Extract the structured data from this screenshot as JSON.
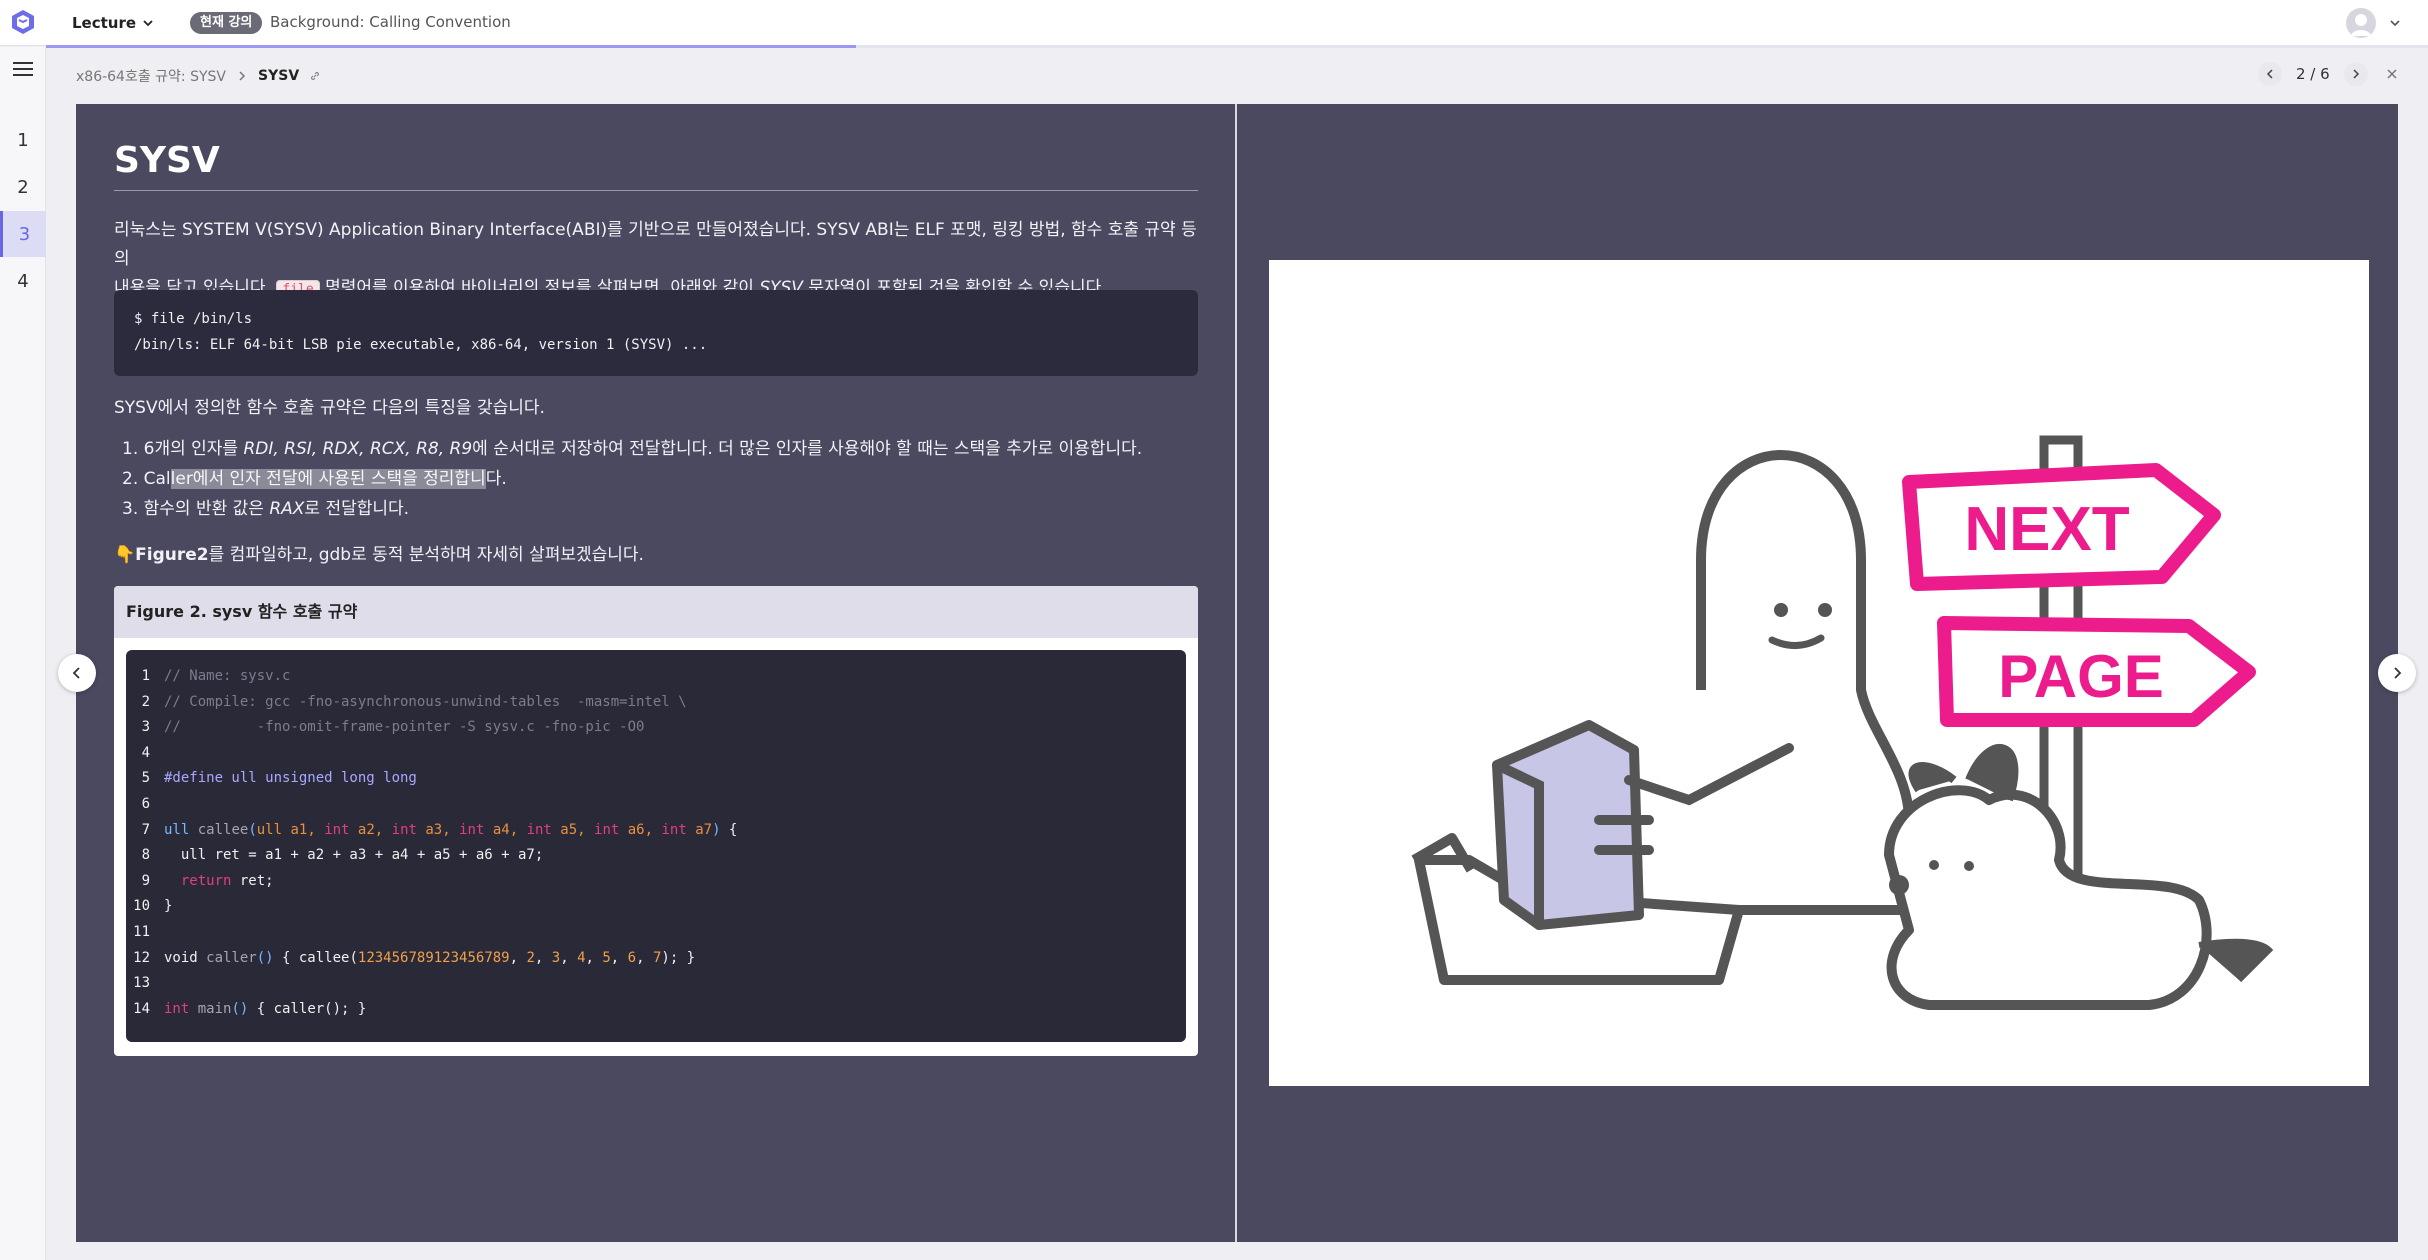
{
  "topbar": {
    "lecture_label": "Lecture",
    "current_badge": "현재 강의",
    "current_title": "Background: Calling Convention",
    "progress_fraction": 0.34
  },
  "rail": {
    "items": [
      {
        "label": "1"
      },
      {
        "label": "2"
      },
      {
        "label": "3"
      },
      {
        "label": "4"
      }
    ],
    "active_index": 2
  },
  "breadcrumb": {
    "parent": "x86-64호출 규약: SYSV",
    "current": "SYSV"
  },
  "pager": {
    "text": "2 / 6"
  },
  "slide": {
    "title": "SYSV",
    "intro_line1": "리눅스는 SYSTEM V(SYSV) Application Binary Interface(ABI)를 기반으로 만들어졌습니다. SYSV ABI는 ELF 포맷, 링킹 방법, 함수 호출 규약 등의",
    "intro_line2_a": "내용을 담고 있습니다. ",
    "intro_code": "file",
    "intro_line2_b": " 명령어를 이용하여 바이너리의 정보를 살펴보면, 아래와 같이 ",
    "intro_italic": "SYSV",
    "intro_line2_c": " 문자열이 포함된 것을 확인할 수 있습니다.",
    "terminal": [
      "$ file /bin/ls",
      "/bin/ls: ELF 64-bit LSB pie executable, x86-64, version 1 (SYSV) ..."
    ],
    "features_intro": "SYSV에서 정의한 함수 호출 규약은 다음의 특징을 갖습니다.",
    "features": {
      "f1_a": "1. 6개의 인자를 ",
      "f1_regs": "RDI, RSI, RDX, RCX, R8, R9",
      "f1_b": "에 순서대로 저장하여 전달합니다. 더 많은 인자를 사용해야 할 때는 스택을 추가로 이용합니다.",
      "f2_a": "2. Cal",
      "f2_hl": "ler에서 인자 전달에 사용된 스택을 정리합니",
      "f2_b": "다.",
      "f3_a": "3. 함수의 반환 값은 ",
      "f3_reg": "RAX",
      "f3_b": "로 전달합니다."
    },
    "hint_emoji": "👇",
    "hint_bold": "Figure2",
    "hint_rest": "를 컴파일하고, gdb로 동적 분석하며 자세히 살펴보겠습니다.",
    "figure_caption": "Figure 2. sysv 함수 호출 규약"
  },
  "code": {
    "line_numbers": [
      "1",
      "2",
      "3",
      "4",
      "5",
      "6",
      "7",
      "8",
      "9",
      "10",
      "11",
      "12",
      "13",
      "14"
    ],
    "l1": "// Name: sysv.c",
    "l2": "// Compile: gcc -fno-asynchronous-unwind-tables  -masm=intel \\",
    "l3": "//         -fno-omit-frame-pointer -S sysv.c -fno-pic -O0",
    "l5": "#define ull unsigned long long",
    "l7": {
      "t1": "ull",
      "fn": "callee",
      "p1": "(",
      "a1t": "ull",
      "a1": " a1, ",
      "k2": "int",
      "a2": " a2, ",
      "k3": "int",
      "a3": " a3, ",
      "k4": "int",
      "a4": " a4, ",
      "k5": "int",
      "a5": " a5, ",
      "k6": "int",
      "a6": " a6, ",
      "k7": "int",
      "a7": " a7",
      "p2": ")",
      "end": " {"
    },
    "l8": "  ull ret = a1 + a2 + a3 + a4 + a5 + a6 + a7;",
    "l9_kw": "return",
    "l9_rest": " ret;",
    "l10": "}",
    "l12": {
      "kw": "void",
      "fn": " caller",
      "p": "()",
      "a": " { callee(",
      "n1": "123456789123456789",
      "c1": ", ",
      "n2": "2",
      "c2": ", ",
      "n3": "3",
      "c3": ", ",
      "n4": "4",
      "c4": ", ",
      "n5": "5",
      "c5": ", ",
      "n6": "6",
      "c6": ", ",
      "n7": "7",
      "e": "); }"
    },
    "l14": {
      "kw": "int",
      "fn": " main",
      "p": "()",
      "rest": " { caller(); }"
    }
  },
  "next_page_art": {
    "sign_top": "NEXT",
    "sign_bottom": "PAGE",
    "accent": "#ec1c8c"
  },
  "colors": {
    "stage_bg": "#4a4960",
    "accent": "#6967e6",
    "code_bg": "#2a2938"
  }
}
